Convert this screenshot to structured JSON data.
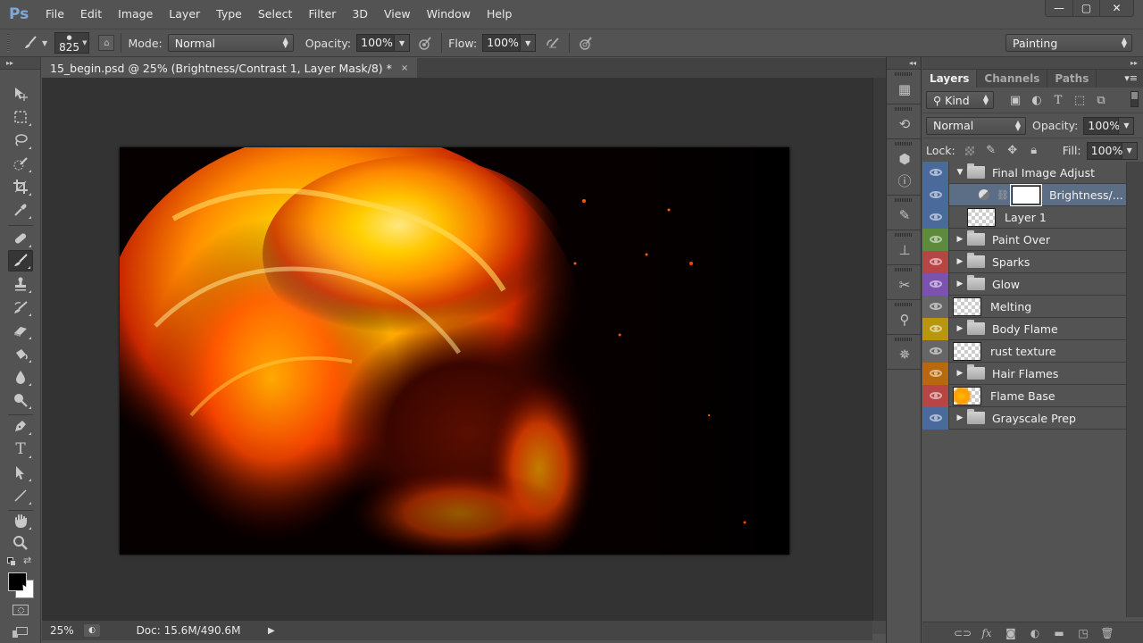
{
  "app": {
    "logo": "Ps"
  },
  "menu": [
    "File",
    "Edit",
    "Image",
    "Layer",
    "Type",
    "Select",
    "Filter",
    "3D",
    "View",
    "Window",
    "Help"
  ],
  "window_controls": {
    "minimize": "—",
    "maximize": "▢",
    "close": "✕"
  },
  "options_bar": {
    "brush_size": "825",
    "mode_label": "Mode:",
    "mode_value": "Normal",
    "opacity_label": "Opacity:",
    "opacity_value": "100%",
    "flow_label": "Flow:",
    "flow_value": "100%",
    "workspace": "Painting"
  },
  "document": {
    "tab_title": "15_begin.psd @ 25% (Brightness/Contrast 1, Layer Mask/8) *",
    "close": "×"
  },
  "status_bar": {
    "zoom": "25%",
    "doc_info": "Doc: 15.6M/490.6M",
    "arrow": "▶"
  },
  "tools": [
    {
      "name": "move-tool"
    },
    {
      "name": "marquee-tool"
    },
    {
      "name": "lasso-tool"
    },
    {
      "name": "quick-selection-tool"
    },
    {
      "name": "crop-tool"
    },
    {
      "name": "eyedropper-tool"
    },
    {
      "name": "healing-brush-tool"
    },
    {
      "name": "brush-tool",
      "active": true
    },
    {
      "name": "clone-stamp-tool"
    },
    {
      "name": "history-brush-tool"
    },
    {
      "name": "eraser-tool"
    },
    {
      "name": "paint-bucket-tool"
    },
    {
      "name": "blur-tool"
    },
    {
      "name": "dodge-tool"
    },
    {
      "name": "pen-tool"
    },
    {
      "name": "type-tool"
    },
    {
      "name": "path-selection-tool"
    },
    {
      "name": "line-tool"
    },
    {
      "name": "hand-tool"
    },
    {
      "name": "zoom-tool"
    }
  ],
  "colors": {
    "foreground": "#000000",
    "background": "#ffffff",
    "selection_blue": "#5c6d86"
  },
  "layers_panel": {
    "tabs": [
      "Layers",
      "Channels",
      "Paths"
    ],
    "active_tab": "Layers",
    "filter_kind": "Kind",
    "blend_mode": "Normal",
    "opacity_label": "Opacity:",
    "opacity_value": "100%",
    "lock_label": "Lock:",
    "fill_label": "Fill:",
    "fill_value": "100%",
    "layers": [
      {
        "name": "Final Image Adjust",
        "type": "group",
        "expanded": true,
        "color": "#4a6a9c"
      },
      {
        "name": "Brightness/...",
        "type": "adjustment",
        "selected": true,
        "color": "#4a6a9c"
      },
      {
        "name": "Layer 1",
        "type": "pixel",
        "color": "#4a6a9c"
      },
      {
        "name": "Paint Over",
        "type": "group",
        "color": "#5e8a3c"
      },
      {
        "name": "Sparks",
        "type": "group",
        "color": "#b84545"
      },
      {
        "name": "Glow",
        "type": "group",
        "color": "#7b52ad"
      },
      {
        "name": "Melting",
        "type": "pixel",
        "color": "#666666"
      },
      {
        "name": "Body Flame",
        "type": "group",
        "color": "#b8960e"
      },
      {
        "name": "rust texture",
        "type": "pixel",
        "color": "#666666"
      },
      {
        "name": "Hair Flames",
        "type": "group",
        "color": "#b8690e"
      },
      {
        "name": "Flame Base",
        "type": "pixel",
        "thumb": "flame",
        "color": "#b84545"
      },
      {
        "name": "Grayscale Prep",
        "type": "group",
        "color": "#4a6a9c"
      }
    ]
  }
}
